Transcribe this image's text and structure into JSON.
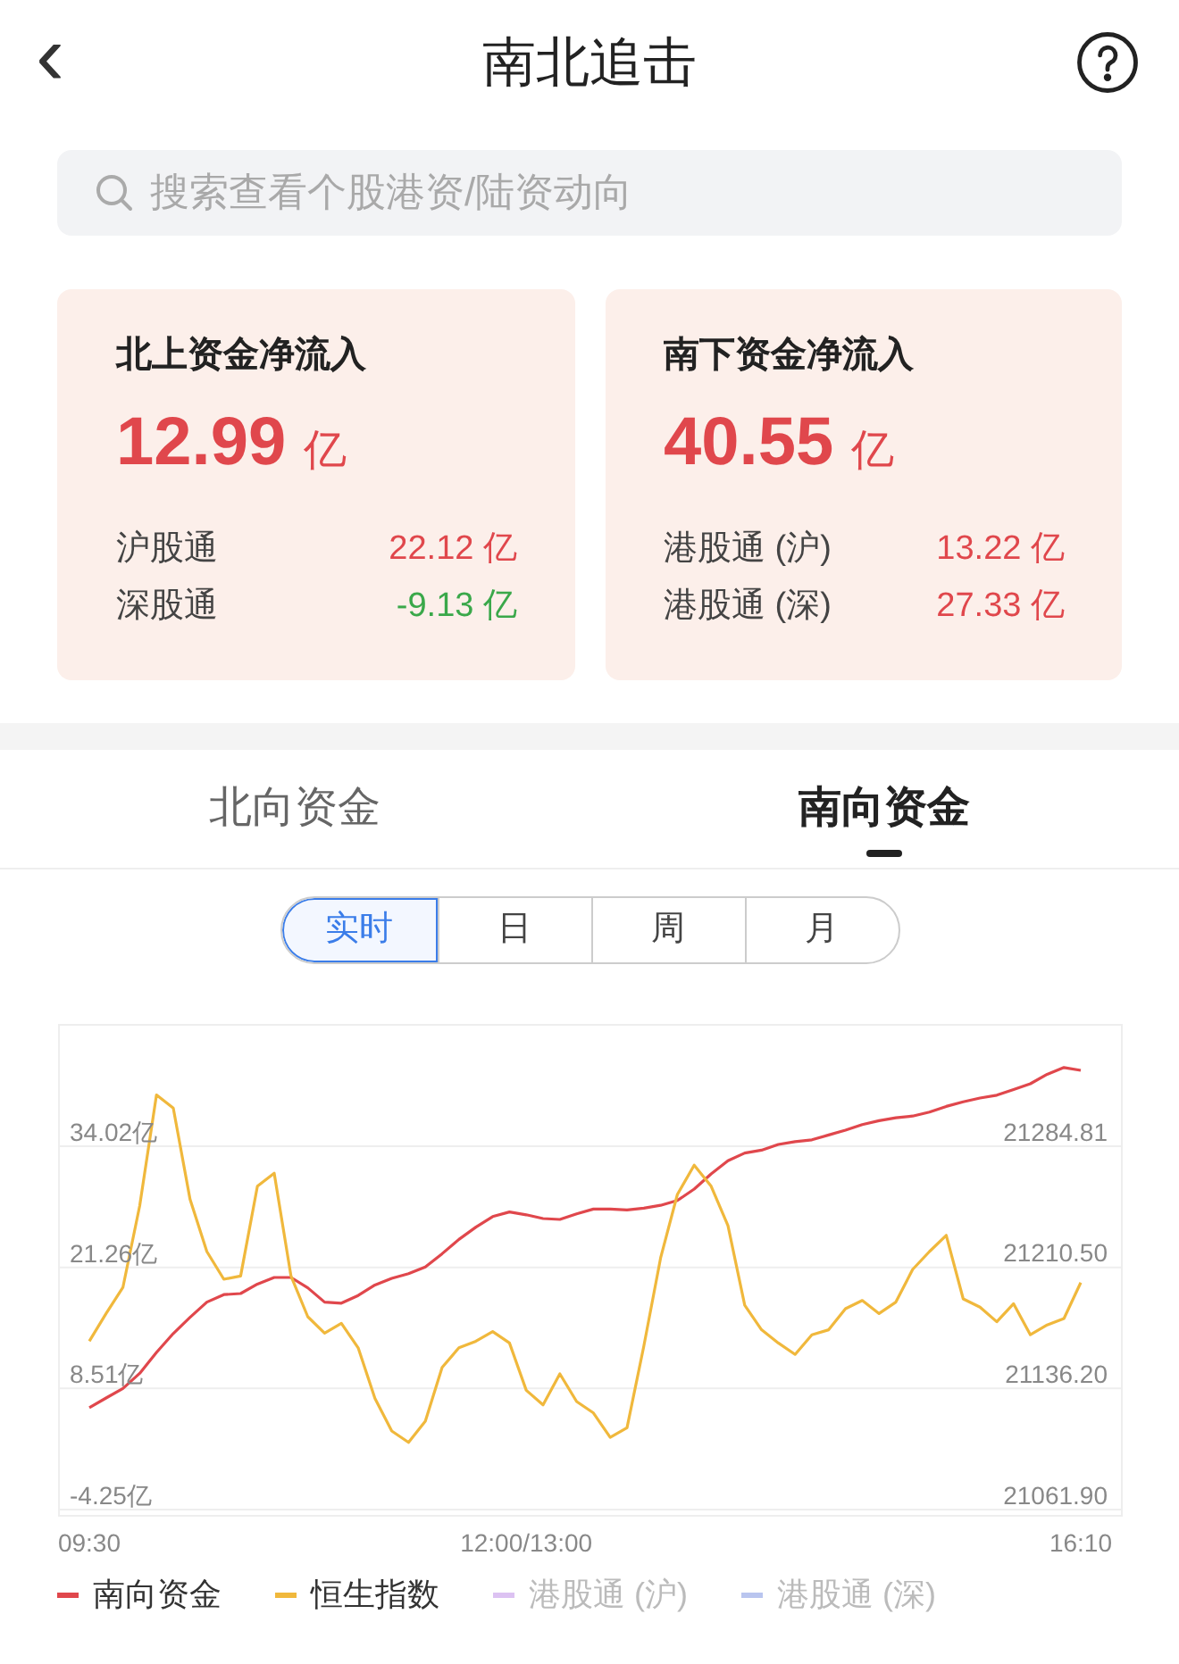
{
  "header": {
    "title": "南北追击",
    "back_icon": "‹"
  },
  "search": {
    "placeholder": "搜索查看个股港资/陆资动向"
  },
  "cards": [
    {
      "title": "北上资金净流入",
      "amount": "12.99",
      "unit": "亿",
      "rows": [
        {
          "label": "沪股通",
          "value": "22.12 亿",
          "color": "#e0474c"
        },
        {
          "label": "深股通",
          "value": "-9.13 亿",
          "color": "#3aa84a"
        }
      ]
    },
    {
      "title": "南下资金净流入",
      "amount": "40.55",
      "unit": "亿",
      "rows": [
        {
          "label": "港股通 (沪)",
          "value": "13.22 亿",
          "color": "#e0474c"
        },
        {
          "label": "港股通 (深)",
          "value": "27.33 亿",
          "color": "#e0474c"
        }
      ]
    }
  ],
  "tabs": [
    {
      "label": "北向资金",
      "selected": false
    },
    {
      "label": "南向资金",
      "selected": true
    }
  ],
  "periods": [
    {
      "label": "实时",
      "selected": true
    },
    {
      "label": "日",
      "selected": false
    },
    {
      "label": "周",
      "selected": false
    },
    {
      "label": "月",
      "selected": false
    }
  ],
  "chart": {
    "chart_data": {
      "type": "line",
      "categories": [
        "09:30",
        null,
        null,
        null,
        null,
        null,
        null,
        null,
        null,
        null,
        null,
        null,
        null,
        null,
        null,
        null,
        null,
        null,
        null,
        null,
        null,
        null,
        null,
        null,
        null,
        null,
        "12:00/13:00",
        null,
        null,
        null,
        null,
        null,
        null,
        null,
        null,
        null,
        null,
        null,
        null,
        null,
        null,
        null,
        null,
        null,
        null,
        null,
        null,
        null,
        null,
        null,
        null,
        null,
        null,
        null,
        null,
        null,
        null,
        null,
        null,
        "16:10"
      ],
      "ylim": [
        -4.9,
        46.8
      ],
      "yticks": [
        {
          "value": -4.25,
          "label": "-4.25亿"
        },
        {
          "value": 8.51,
          "label": "8.51亿"
        },
        {
          "value": 21.26,
          "label": "21.26亿"
        },
        {
          "value": 34.02,
          "label": "34.02亿"
        }
      ],
      "y2lim": [
        21058,
        21359
      ],
      "y2ticks": [
        {
          "value": 21061.9,
          "label": "21061.90"
        },
        {
          "value": 21136.2,
          "label": "21136.20"
        },
        {
          "value": 21210.5,
          "label": "21210.50"
        },
        {
          "value": 21284.81,
          "label": "21284.81"
        }
      ],
      "grid": true,
      "legend": true,
      "series": [
        {
          "name": "南向资金",
          "color": "#e0474c",
          "values": [
            6.5,
            7.5,
            8.5,
            10.1,
            12.3,
            14.3,
            16.0,
            17.6,
            18.4,
            18.5,
            19.5,
            20.2,
            20.2,
            19.1,
            17.6,
            17.5,
            18.3,
            19.4,
            20.1,
            20.6,
            21.3,
            22.7,
            24.2,
            25.5,
            26.6,
            27.1,
            26.8,
            26.4,
            26.3,
            26.9,
            27.4,
            27.4,
            27.3,
            27.5,
            27.8,
            28.3,
            29.5,
            31.1,
            32.5,
            33.3,
            33.6,
            34.2,
            34.5,
            34.7,
            35.2,
            35.7,
            36.3,
            36.7,
            37.0,
            37.2,
            37.6,
            38.2,
            38.7,
            39.1,
            39.4,
            40.0,
            40.6,
            41.6,
            42.3,
            42.0
          ]
        },
        {
          "name": "恒生指数",
          "color": "#f0b83c",
          "axis": "y2",
          "values": [
            21165,
            21182,
            21198,
            21248,
            21316,
            21308,
            21252,
            21220,
            21203,
            21205,
            21260,
            21268,
            21205,
            21180,
            21170,
            21176,
            21161,
            21130,
            21110,
            21103,
            21116,
            21149,
            21161,
            21165,
            21171,
            21164,
            21135,
            21126,
            21145,
            21128,
            21121,
            21106,
            21112,
            21162,
            21216,
            21255,
            21273,
            21260,
            21236,
            21187,
            21172,
            21164,
            21157,
            21169,
            21172,
            21185,
            21190,
            21182,
            21189,
            21209,
            21220,
            21230,
            21191,
            21186,
            21177,
            21188,
            21169,
            21175,
            21179,
            21201
          ]
        },
        {
          "name": "港股通 (沪)",
          "color": "#dcc2f2",
          "values": [
            null,
            null,
            null,
            null,
            null,
            null,
            null,
            null,
            null,
            null,
            null,
            null,
            null,
            null,
            null,
            null,
            null,
            null,
            null,
            null,
            null,
            null,
            null,
            null,
            null,
            null,
            null,
            null,
            null,
            null,
            null,
            null,
            null,
            null,
            null,
            null,
            null,
            null,
            null,
            null,
            null,
            null,
            null,
            null,
            null,
            null,
            null,
            null,
            null,
            null,
            null,
            null,
            null,
            null,
            null,
            null,
            null,
            null,
            null,
            null
          ]
        },
        {
          "name": "港股通 (深)",
          "color": "#b9c5ef",
          "values": [
            null,
            null,
            null,
            null,
            null,
            null,
            null,
            null,
            null,
            null,
            null,
            null,
            null,
            null,
            null,
            null,
            null,
            null,
            null,
            null,
            null,
            null,
            null,
            null,
            null,
            null,
            null,
            null,
            null,
            null,
            null,
            null,
            null,
            null,
            null,
            null,
            null,
            null,
            null,
            null,
            null,
            null,
            null,
            null,
            null,
            null,
            null,
            null,
            null,
            null,
            null,
            null,
            null,
            null,
            null,
            null,
            null,
            null,
            null,
            null
          ]
        }
      ]
    }
  }
}
